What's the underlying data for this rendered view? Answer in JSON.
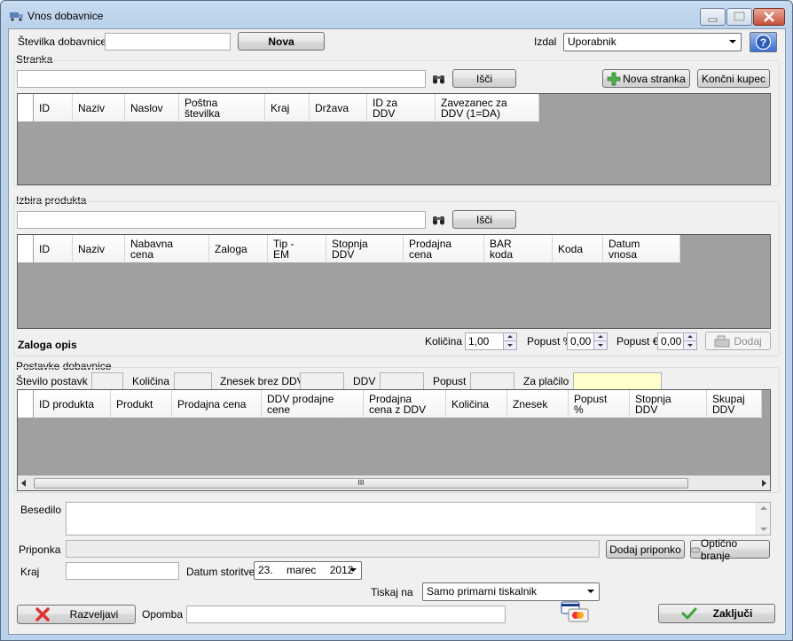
{
  "window": {
    "title": "Vnos dobavnice"
  },
  "header": {
    "stevilka_label": "Številka dobavnice",
    "stevilka_value": "",
    "nova_button": "Nova",
    "izdal_label": "Izdal",
    "izdal_value": "Uporabnik"
  },
  "stranka": {
    "group_label": "Stranka",
    "search_value": "",
    "isci_button": "Išči",
    "nova_stranka_button": "Nova stranka",
    "koncni_kupec_button": "Končni kupec",
    "columns": [
      "ID",
      "Naziv",
      "Naslov",
      "Poštna\nštevilka",
      "Kraj",
      "Država",
      "ID za\nDDV",
      "Zavezanec za\nDDV (1=DA)"
    ]
  },
  "produkt": {
    "group_label": "Izbira produkta",
    "search_value": "",
    "isci_button": "Išči",
    "columns": [
      "ID",
      "Naziv",
      "Nabavna\ncena",
      "Zaloga",
      "Tip -\nEM",
      "Stopnja\nDDV",
      "Prodajna\ncena",
      "BAR\nkoda",
      "Koda",
      "Datum\nvnosa"
    ],
    "zaloga_opis_label": "Zaloga opis",
    "kolicina_label": "Količina",
    "kolicina_value": "1,00",
    "popust_pct_label": "Popust %",
    "popust_pct_value": "0,00",
    "popust_eur_label": "Popust €",
    "popust_eur_value": "0,00",
    "dodaj_button": "Dodaj"
  },
  "postavke": {
    "group_label": "Postavke dobavnice",
    "stevilo_label": "Število postavk",
    "kolicina_label": "Količina",
    "znesek_brez_label": "Znesek brez DDV",
    "ddv_label": "DDV",
    "popust_label": "Popust",
    "za_placilo_label": "Za plačilo",
    "columns": [
      "ID produkta",
      "Produkt",
      "Prodajna cena",
      "DDV prodajne\ncene",
      "Prodajna\ncena z DDV",
      "Količina",
      "Znesek",
      "Popust\n%",
      "Stopnja\nDDV",
      "Skupaj\nDDV"
    ],
    "scroll_grip": "III"
  },
  "footer": {
    "besedilo_label": "Besedilo",
    "priponka_label": "Priponka",
    "dodaj_priponko_button": "Dodaj priponko",
    "opticno_branje_button": "Optično branje",
    "kraj_label": "Kraj",
    "datum_label": "Datum storitve",
    "datum_day": "23.",
    "datum_month": "marec",
    "datum_year": "2012",
    "tiskaj_label": "Tiskaj na",
    "tiskaj_value": "Samo primarni tiskalnik",
    "razveljavi_button": "Razveljavi",
    "opomba_label": "Opomba",
    "zakljuci_button": "Zaključi"
  },
  "colors": {
    "za_placilo_bg": "#ffffcc",
    "grid_bg": "#a0a0a0",
    "help_blue": "#3a6fd8",
    "green_check": "#3aa33a",
    "red_x": "#d33"
  }
}
